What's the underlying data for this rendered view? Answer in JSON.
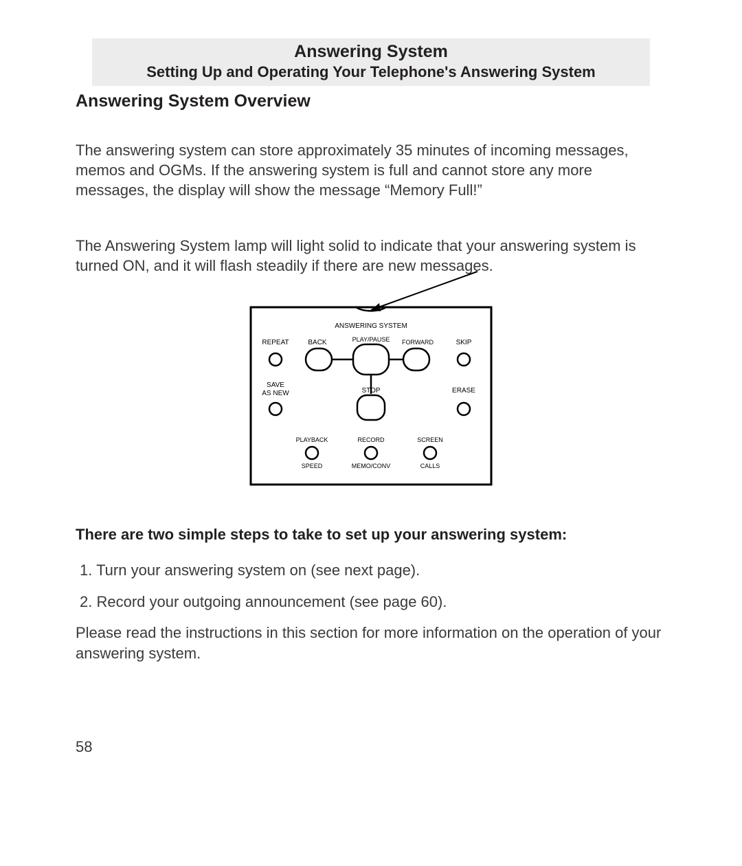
{
  "header": {
    "title": "Answering System",
    "subtitle": "Setting Up and Operating Your Telephone's Answering System"
  },
  "section_heading": "Answering System Overview",
  "paragraph1": "The answering system can store approximately 35 minutes of incoming mes­sages, memos and OGMs. If the answering system is full and cannot store any more messages, the display will show the message “Memory Full!”",
  "paragraph2": "The Answering System lamp will light solid to indicate that your answering sys­tem is turned ON, and it will flash steadily if there are new messages.",
  "diagram": {
    "title_label": "ANSWERING SYSTEM",
    "row1": {
      "repeat": "REPEAT",
      "back": "BACK",
      "play_pause": "PLAY/PAUSE",
      "forward": "FORWARD",
      "skip": "SKIP"
    },
    "row2": {
      "save_as_new_line1": "SAVE",
      "save_as_new_line2": "AS NEW",
      "stop": "STOP",
      "erase": "ERASE"
    },
    "row3": {
      "playback_line1": "PLAYBACK",
      "playback_line2": "SPEED",
      "record_line1": "RECORD",
      "record_line2": "MEMO/CONV",
      "screen_line1": "SCREEN",
      "screen_line2": "CALLS"
    }
  },
  "steps_heading": "There are two simple steps to take to set up your answering system:",
  "step1": "1.  Turn your answering system on (see next page).",
  "step2": "2. Record your outgoing announcement (see page 60).",
  "paragraph3": "Please read the instructions in this section for more information on the operation of your answering system.",
  "page_number": "58"
}
